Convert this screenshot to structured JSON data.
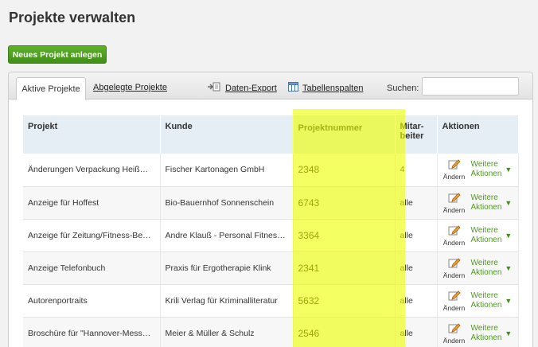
{
  "page": {
    "title": "Projekte verwalten"
  },
  "toolbar": {
    "new_project_label": "Neues Projekt anlegen"
  },
  "tabs": [
    {
      "label": "Aktive Projekte",
      "active": true
    },
    {
      "label": "Abgelegte Projekte",
      "active": false
    }
  ],
  "panel_tools": {
    "export_label": "Daten-Export",
    "columns_label": "Tabellenspalten",
    "search_label": "Suchen:",
    "search_value": ""
  },
  "table": {
    "headers": {
      "projekt": "Projekt",
      "kunde": "Kunde",
      "projektnummer": "Projektnummer",
      "mitarbeiter_1": "Mitar-",
      "mitarbeiter_2": "beiter",
      "aktionen": "Aktionen"
    },
    "action_labels": {
      "edit": "Ändern",
      "more_1": "Weitere",
      "more_2": "Aktionen"
    },
    "rows": [
      {
        "projekt": "Änderungen Verpackung Heiß…",
        "kunde": "Fischer Kartonagen GmbH",
        "projektnummer": "2348",
        "mitarbeiter": "4"
      },
      {
        "projekt": "Anzeige für Hoffest",
        "kunde": "Bio-Bauernhof Sonnenschein",
        "projektnummer": "6743",
        "mitarbeiter": "alle"
      },
      {
        "projekt": "Anzeige für Zeitung/Fitness-Be…",
        "kunde": "Andre Klauß - Personal Fitnes…",
        "projektnummer": "3364",
        "mitarbeiter": "alle"
      },
      {
        "projekt": "Anzeige Telefonbuch",
        "kunde": "Praxis für Ergotherapie Klink",
        "projektnummer": "2341",
        "mitarbeiter": "alle"
      },
      {
        "projekt": "Autorenportraits",
        "kunde": "Krili Verlag für Kriminalliteratur",
        "projektnummer": "5632",
        "mitarbeiter": "alle"
      },
      {
        "projekt": "Broschüre für \"Hannover-Mess…",
        "kunde": "Meier & Müller & Schulz",
        "projektnummer": "2546",
        "mitarbeiter": "alle"
      }
    ]
  },
  "colors": {
    "accent_green": "#4d9a1c",
    "header_blue": "#e5edf5",
    "highlight_yellow": "#eeff00"
  },
  "icons": {
    "export": "export-arrow-icon",
    "columns": "table-columns-icon",
    "edit": "edit-pencil-icon",
    "more": "caret-down-icon"
  }
}
